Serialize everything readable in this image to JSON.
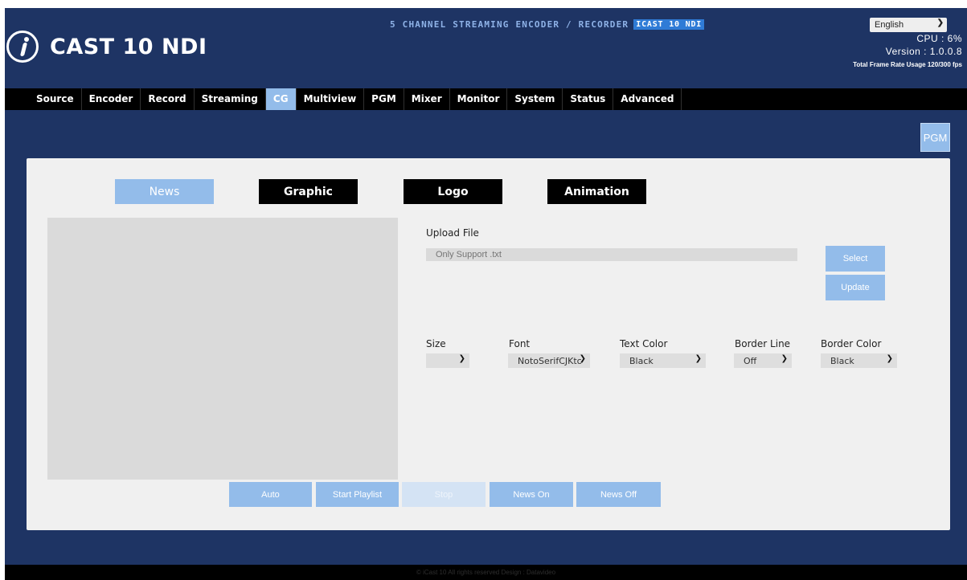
{
  "header": {
    "logo_text": "CAST 10 NDI",
    "banner_text": "5 CHANNEL STREAMING ENCODER / RECORDER",
    "banner_tag": "ICAST 10 NDI",
    "language": "English",
    "cpu": "CPU : 6%",
    "version": "Version : 1.0.0.8",
    "frame_rate": "Total Frame Rate Usage 120/300 fps"
  },
  "nav": {
    "items": [
      "Source",
      "Encoder",
      "Record",
      "Streaming",
      "CG",
      "Multiview",
      "PGM",
      "Mixer",
      "Monitor",
      "System",
      "Status",
      "Advanced"
    ],
    "active": "CG"
  },
  "pgm_button": "PGM",
  "cg": {
    "tabs": [
      "News",
      "Graphic",
      "Logo",
      "Animation"
    ],
    "active_tab": "News",
    "upload_label": "Upload File",
    "upload_placeholder": "Only Support .txt",
    "select_button": "Select",
    "update_button": "Update",
    "options": {
      "size": {
        "label": "Size",
        "value": ""
      },
      "font": {
        "label": "Font",
        "value": "NotoSerifCJKtc"
      },
      "text_color": {
        "label": "Text Color",
        "value": "Black"
      },
      "border_line": {
        "label": "Border Line",
        "value": "Off"
      },
      "border_color": {
        "label": "Border Color",
        "value": "Black"
      }
    },
    "actions": {
      "auto": "Auto",
      "start_playlist": "Start Playlist",
      "stop": "Stop",
      "news_on": "News On",
      "news_off": "News Off"
    }
  },
  "footer": "© iCast 10 All rights reserved Design : Datavideo",
  "colors": {
    "background": "#1e3464",
    "accent": "#93bcea",
    "nav_bar": "#000000",
    "panel": "#f0f0f0"
  }
}
